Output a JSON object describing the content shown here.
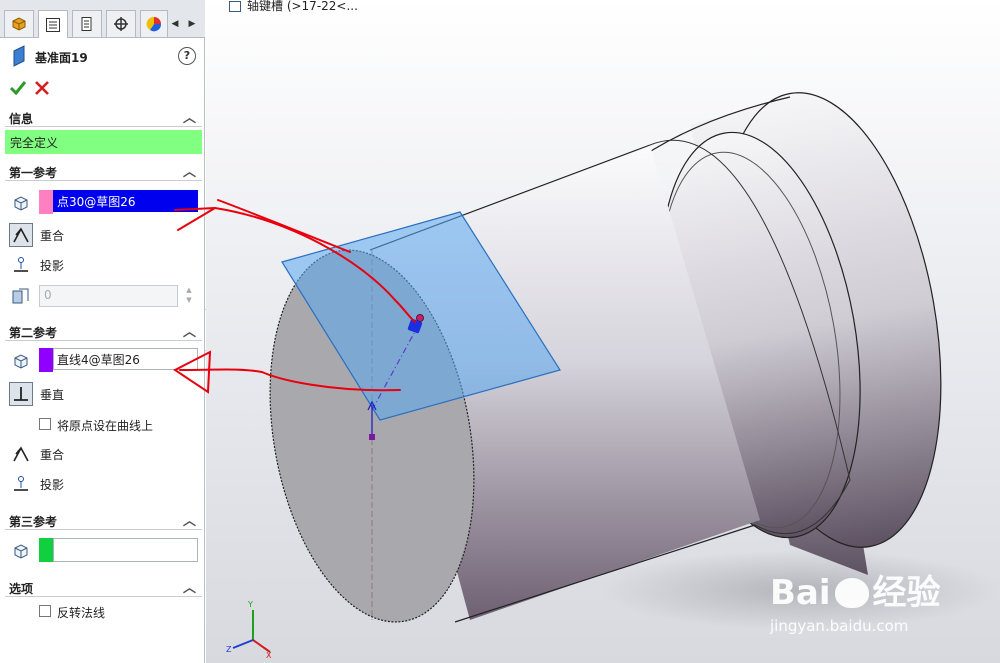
{
  "feature": {
    "title": "基准面19"
  },
  "info": {
    "header": "信息",
    "status": "完全定义"
  },
  "ref1": {
    "header": "第一参考",
    "value": "点30@草图26",
    "swatch_color": "#ff80c0",
    "options": [
      "重合",
      "投影"
    ],
    "distance_value": "0"
  },
  "ref2": {
    "header": "第二参考",
    "value": "直线4@草图26",
    "swatch_color": "#9000ff",
    "options": [
      "垂直",
      "将原点设在曲线上",
      "重合",
      "投影"
    ]
  },
  "ref3": {
    "header": "第三参考",
    "value": "",
    "swatch_color": "#10d040"
  },
  "options": {
    "header": "选项",
    "flip_normal": "反转法线"
  },
  "tree": {
    "item": "轴键槽 (>17-22<..."
  },
  "watermark": {
    "brand": "Bai",
    "brand2": "经验",
    "url": "jingyan.baidu.com"
  },
  "colors": {
    "status_bg": "#80ff80",
    "selection_bg": "#0000ee",
    "plane_fill": "#5aa8f0",
    "annotation_red": "#e8000e"
  }
}
